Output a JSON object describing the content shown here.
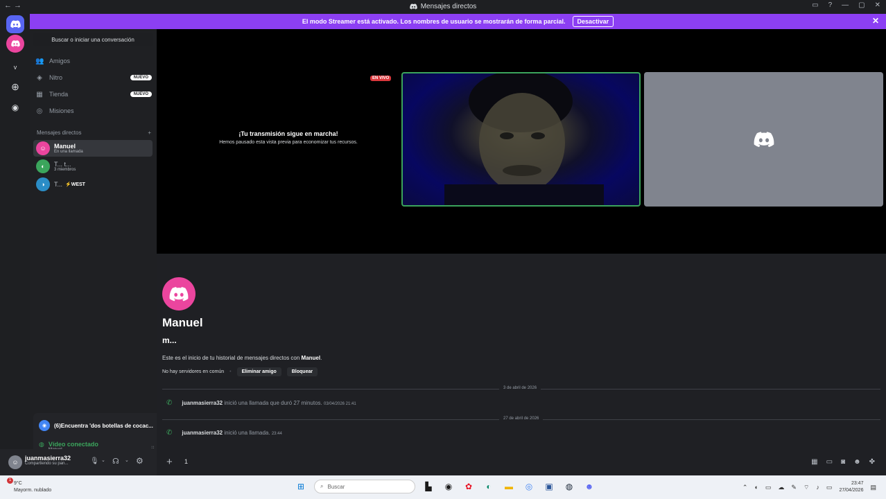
{
  "window": {
    "title": "Mensajes directos"
  },
  "banner": {
    "text": "El modo Streamer está activado. Los nombres de usuario se mostrarán de forma parcial.",
    "button": "Desactivar"
  },
  "sidebar": {
    "search_placeholder": "Buscar o iniciar una conversación",
    "nav": [
      {
        "label": "Amigos",
        "icon": "friends-icon",
        "badge": ""
      },
      {
        "label": "Nitro",
        "icon": "nitro-icon",
        "badge": "NUEVO"
      },
      {
        "label": "Tienda",
        "icon": "shop-icon",
        "badge": "NUEVO"
      },
      {
        "label": "Misiones",
        "icon": "quests-icon",
        "badge": ""
      }
    ],
    "dm_header": "Mensajes directos",
    "dms": [
      {
        "name": "Manuel",
        "status": "En una llamada"
      },
      {
        "name": "T... t...",
        "status": "3 miembros"
      },
      {
        "name": "T...",
        "status": "⚡WEST"
      }
    ]
  },
  "voice": {
    "activity": "(6)Encuentra 'dos botellas de cocac...",
    "status": "Vídeo conectado",
    "channel": "Manuel"
  },
  "user": {
    "name": "juanmasierra32",
    "status": "Compartiendo su pan..."
  },
  "stage": {
    "live_badge": "EN VIVO",
    "paused_title": "¡Tu transmisión sigue en marcha!",
    "paused_sub": "Hemos pausado esta vista previa para economizar tus recursos."
  },
  "chat": {
    "username": "Manuel",
    "handle": "m...",
    "intro_prefix": "Este es el inicio de tu historial de mensajes directos con ",
    "intro_name": "Manuel",
    "intro_suffix": ".",
    "no_servers": "No hay servidores en común",
    "remove_friend": "Eliminar amigo",
    "block": "Bloquear",
    "date1": "3 de abril de 2026",
    "call1_user": "juanmasierra32",
    "call1_text": "inició una llamada que duró 27 minutos.",
    "call1_ts": "03/04/2026 21:41",
    "date2": "27 de abril de 2026",
    "call2_user": "juanmasierra32",
    "call2_text": "inició una llamada.",
    "call2_ts": "23:44",
    "composer_value": "1"
  },
  "taskbar": {
    "temp": "9°C",
    "weather": "Mayorm. nublado",
    "search": "Buscar",
    "time": "23:47",
    "date": "27/04/2026",
    "notif_count": "1"
  },
  "colors": {
    "accent": "#8c3ff3",
    "brand": "#5865f2",
    "avatar": "#eb459e",
    "green": "#3ba55c",
    "live": "#da373c"
  }
}
